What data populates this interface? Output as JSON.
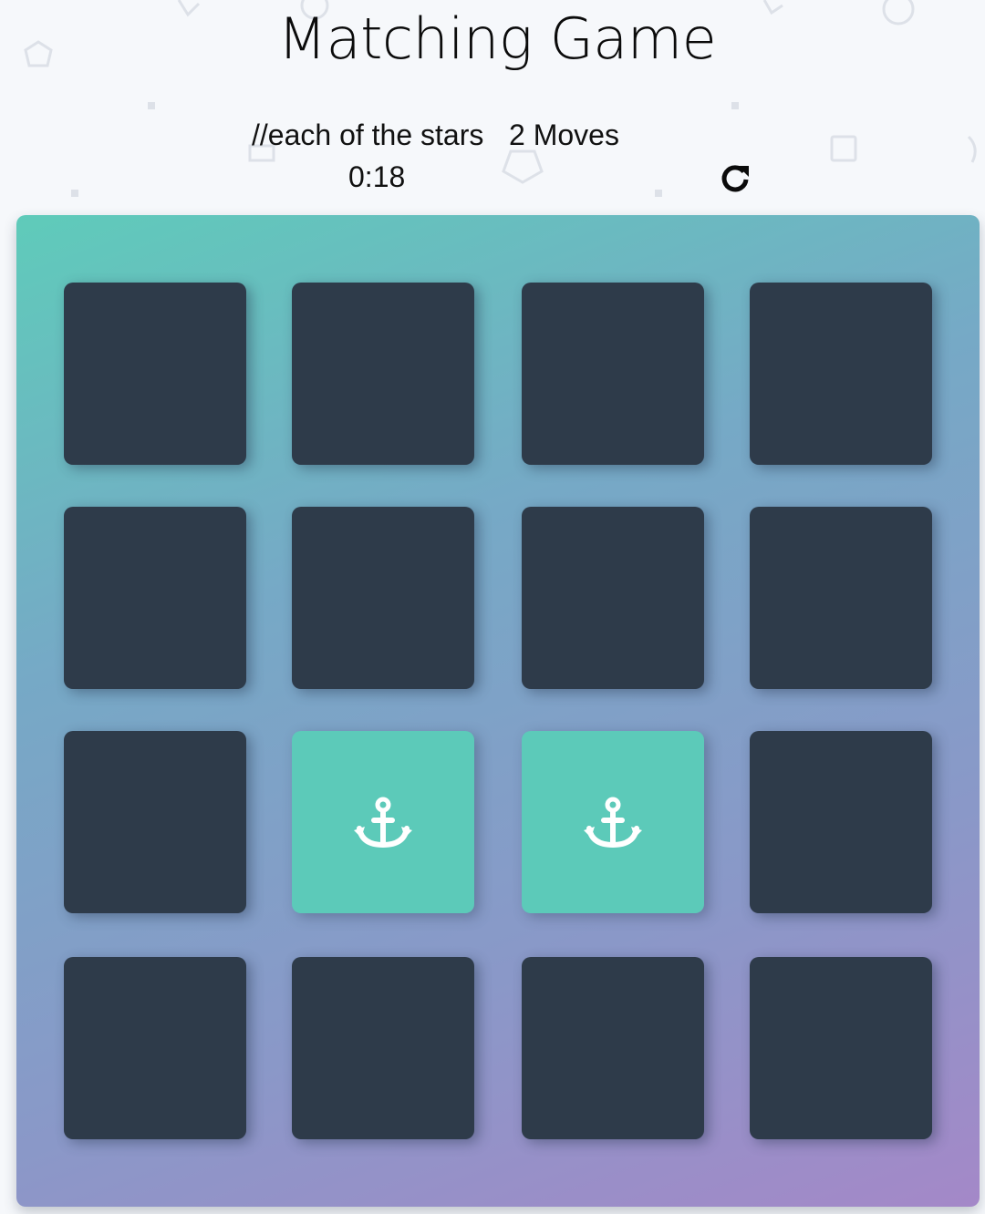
{
  "header": {
    "title": "Matching Game",
    "stars_text": "//each of the stars",
    "moves_text": "2 Moves",
    "timer": "0:18",
    "restart_icon": "refresh-icon"
  },
  "deck": {
    "rows": 4,
    "cols": 4,
    "open_cards": [
      {
        "row": 3,
        "col": 2,
        "icon": "anchor-icon"
      },
      {
        "row": 3,
        "col": 3,
        "icon": "anchor-icon"
      }
    ]
  },
  "colors": {
    "card_closed": "#2e3b4a",
    "card_open": "#5ccab9",
    "deck_gradient_start": "#5fcbba",
    "deck_gradient_end": "#a488c8",
    "background": "#f6f8fb"
  }
}
